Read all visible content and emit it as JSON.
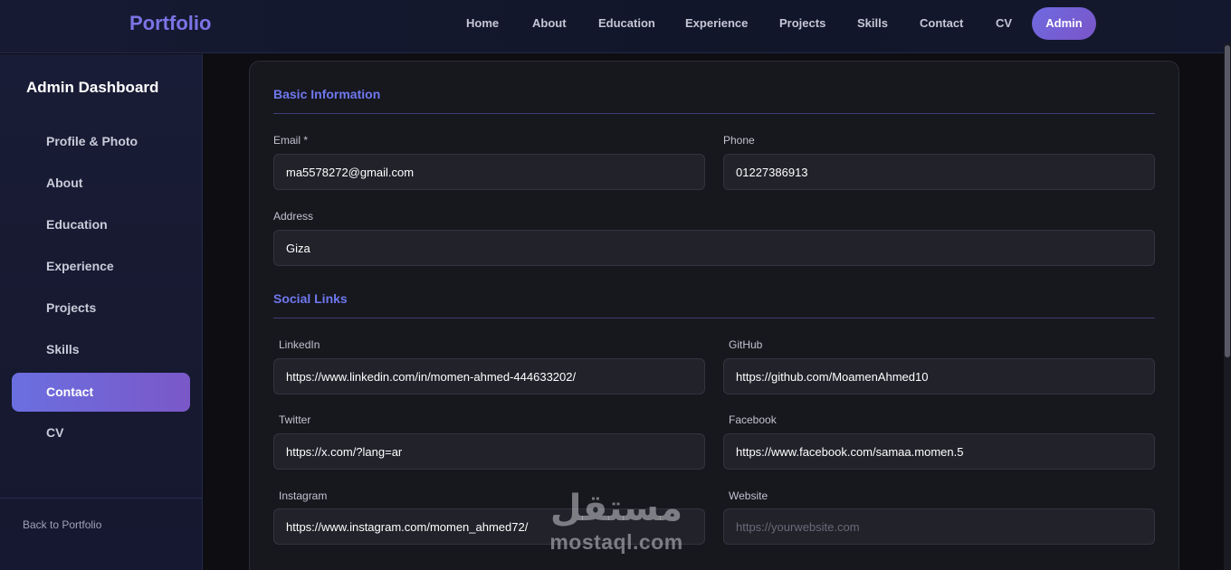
{
  "nav": {
    "brand": "Portfolio",
    "links": [
      "Home",
      "About",
      "Education",
      "Experience",
      "Projects",
      "Skills",
      "Contact",
      "CV"
    ],
    "admin_label": "Admin"
  },
  "sidebar": {
    "title": "Admin Dashboard",
    "items": [
      {
        "label": "Profile & Photo",
        "active": false
      },
      {
        "label": "About",
        "active": false
      },
      {
        "label": "Education",
        "active": false
      },
      {
        "label": "Experience",
        "active": false
      },
      {
        "label": "Projects",
        "active": false
      },
      {
        "label": "Skills",
        "active": false
      },
      {
        "label": "Contact",
        "active": true
      },
      {
        "label": "CV",
        "active": false
      }
    ],
    "back_label": "Back to Portfolio"
  },
  "basic_info": {
    "title": "Basic Information",
    "email": {
      "label": "Email *",
      "value": "ma5578272@gmail.com"
    },
    "phone": {
      "label": "Phone",
      "value": "01227386913"
    },
    "address": {
      "label": "Address",
      "value": "Giza"
    }
  },
  "social_links": {
    "title": "Social Links",
    "linkedin": {
      "label": "LinkedIn",
      "value": "https://www.linkedin.com/in/momen-ahmed-444633202/"
    },
    "github": {
      "label": "GitHub",
      "value": "https://github.com/MoamenAhmed10"
    },
    "twitter": {
      "label": "Twitter",
      "value": "https://x.com/?lang=ar"
    },
    "facebook": {
      "label": "Facebook",
      "value": "https://www.facebook.com/samaa.momen.5"
    },
    "instagram": {
      "label": "Instagram",
      "value": "https://www.instagram.com/momen_ahmed72/"
    },
    "website": {
      "label": "Website",
      "value": "",
      "placeholder": "https://yourwebsite.com"
    }
  },
  "watermark": {
    "arabic": "مستقل",
    "latin": "mostaql.com"
  },
  "colors": {
    "accent": "#6f78ef",
    "brand": "#7b74e6",
    "active_gradient_start": "#6b6fe0",
    "active_gradient_end": "#7a58c8",
    "background": "#0d0d12",
    "card": "#17171e",
    "input": "#22222b"
  }
}
